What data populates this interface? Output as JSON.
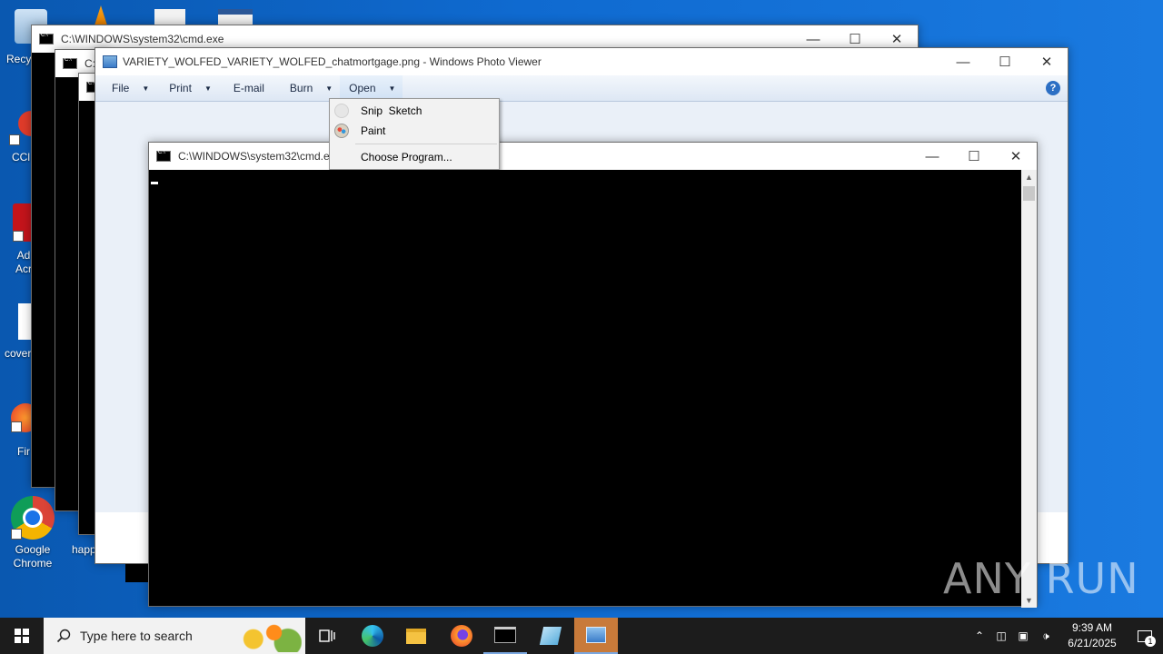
{
  "desktop": {
    "icons": [
      {
        "label": "Recy",
        "icon": "recycle-bin-icon"
      },
      {
        "label": "CCl",
        "icon": "ccleaner-icon"
      },
      {
        "label": "Ad Acr",
        "icon": "adobe-acrobat-icon"
      },
      {
        "label": "cover",
        "icon": "document-icon"
      },
      {
        "label": "Fir",
        "icon": "firefox-icon"
      },
      {
        "label": "Google Chrome",
        "icon": "chrome-icon"
      },
      {
        "label": "happ",
        "icon": "file-icon"
      }
    ]
  },
  "windows": {
    "cmd_back": {
      "title": "C:\\WINDOWS\\system32\\cmd.exe"
    },
    "cmd_2": {
      "title": "C:"
    },
    "photo_viewer": {
      "title": "VARIETY_WOLFED_VARIETY_WOLFED_chatmortgage.png - Windows Photo Viewer",
      "toolbar": {
        "file": "File",
        "print": "Print",
        "email": "E-mail",
        "burn": "Burn",
        "open": "Open"
      }
    },
    "cmd_front": {
      "title": "C:\\WINDOWS\\system32\\cmd.exe"
    }
  },
  "open_menu": {
    "items": [
      {
        "label": "Snip  Sketch",
        "icon": "snip-sketch-icon"
      },
      {
        "label": "Paint",
        "icon": "paint-icon"
      },
      {
        "label": "Choose Program...",
        "icon": ""
      }
    ]
  },
  "taskbar": {
    "search_placeholder": "Type here to search",
    "time": "9:39 AM",
    "date": "6/21/2025",
    "notification_count": "1"
  },
  "watermark": "ANY RUN"
}
